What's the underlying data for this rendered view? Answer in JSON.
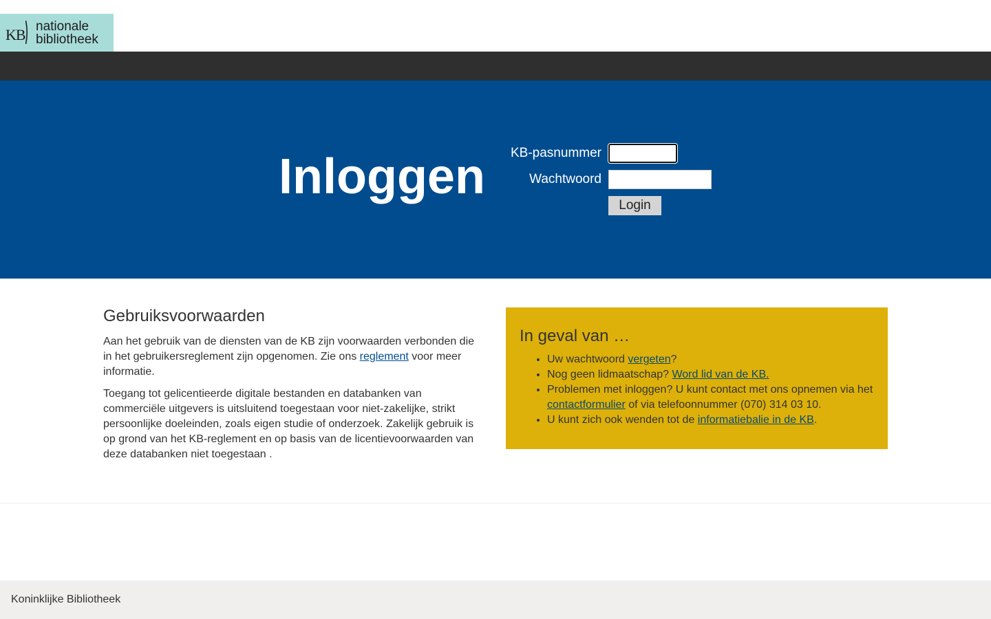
{
  "logo": {
    "abbr": "KB",
    "line1": "nationale",
    "line2": "bibliotheek"
  },
  "hero": {
    "title": "Inloggen",
    "card_label": "KB-pasnummer",
    "password_label": "Wachtwoord",
    "card_value": "",
    "password_value": "",
    "login_button": "Login"
  },
  "terms": {
    "heading": "Gebruiksvoorwaarden",
    "p1_before": "Aan het gebruik van de diensten van de KB zijn voorwaarden verbonden die in het gebruikersreglement zijn opgenomen. Zie ons ",
    "p1_link": "reglement",
    "p1_after": " voor meer informatie.",
    "p2": "Toegang tot gelicentieerde digitale bestanden en databanken van commerciële uitgevers is uitsluitend toegestaan voor niet-zakelijke, strikt persoonlijke doeleinden, zoals eigen studie of onderzoek. Zakelijk gebruik is op grond van het KB-reglement en op basis van de licentievoorwaarden van deze databanken niet toegestaan ."
  },
  "help": {
    "heading": "In geval van …",
    "item1_before": "Uw wachtwoord ",
    "item1_link": "vergeten",
    "item1_after": "?",
    "item2_before": "Nog geen lidmaatschap? ",
    "item2_link": "Word lid van de KB.",
    "item3_before": "Problemen met inloggen? U kunt contact met ons opnemen via het ",
    "item3_link": "contactformulier",
    "item3_after": " of via telefoonnummer (070) 314 03 10.",
    "item4_before": "U kunt zich ook wenden tot de ",
    "item4_link": "informatiebalie in de KB",
    "item4_after": "."
  },
  "footer": {
    "text": "Koninklijke Bibliotheek"
  },
  "colors": {
    "hero_blue": "#004c8f",
    "navbar_dark": "#2f2f2f",
    "logo_teal": "#a8dcd9",
    "help_yellow": "#ddb10a",
    "footer_grey": "#f0efee"
  }
}
